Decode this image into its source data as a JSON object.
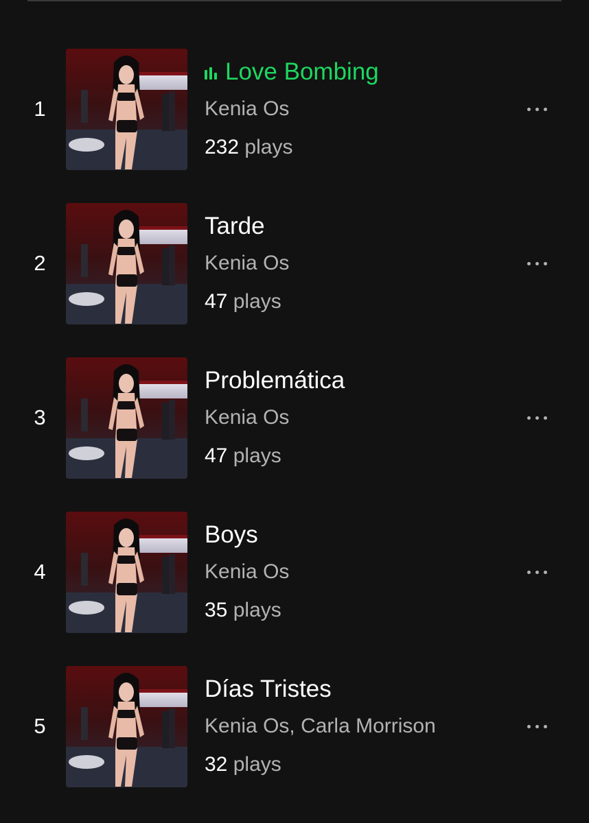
{
  "colors": {
    "background": "#121212",
    "playing_accent": "#1ed760",
    "primary_text": "#ffffff",
    "secondary_text": "#b3b3b3"
  },
  "tracks": [
    {
      "index": "1",
      "title": "Love Bombing",
      "artist": "Kenia Os",
      "plays_count": "232",
      "plays_label": "plays",
      "playing": true,
      "icon": "equalizer-icon"
    },
    {
      "index": "2",
      "title": "Tarde",
      "artist": "Kenia Os",
      "plays_count": "47",
      "plays_label": "plays",
      "playing": false
    },
    {
      "index": "3",
      "title": "Problemática",
      "artist": "Kenia Os",
      "plays_count": "47",
      "plays_label": "plays",
      "playing": false
    },
    {
      "index": "4",
      "title": "Boys",
      "artist": "Kenia Os",
      "plays_count": "35",
      "plays_label": "plays",
      "playing": false
    },
    {
      "index": "5",
      "title": "Días Tristes",
      "artist": "Kenia Os, Carla Morrison",
      "plays_count": "32",
      "plays_label": "plays",
      "playing": false
    }
  ],
  "more_icon": "more-options-icon",
  "cover_art": "album-cover"
}
